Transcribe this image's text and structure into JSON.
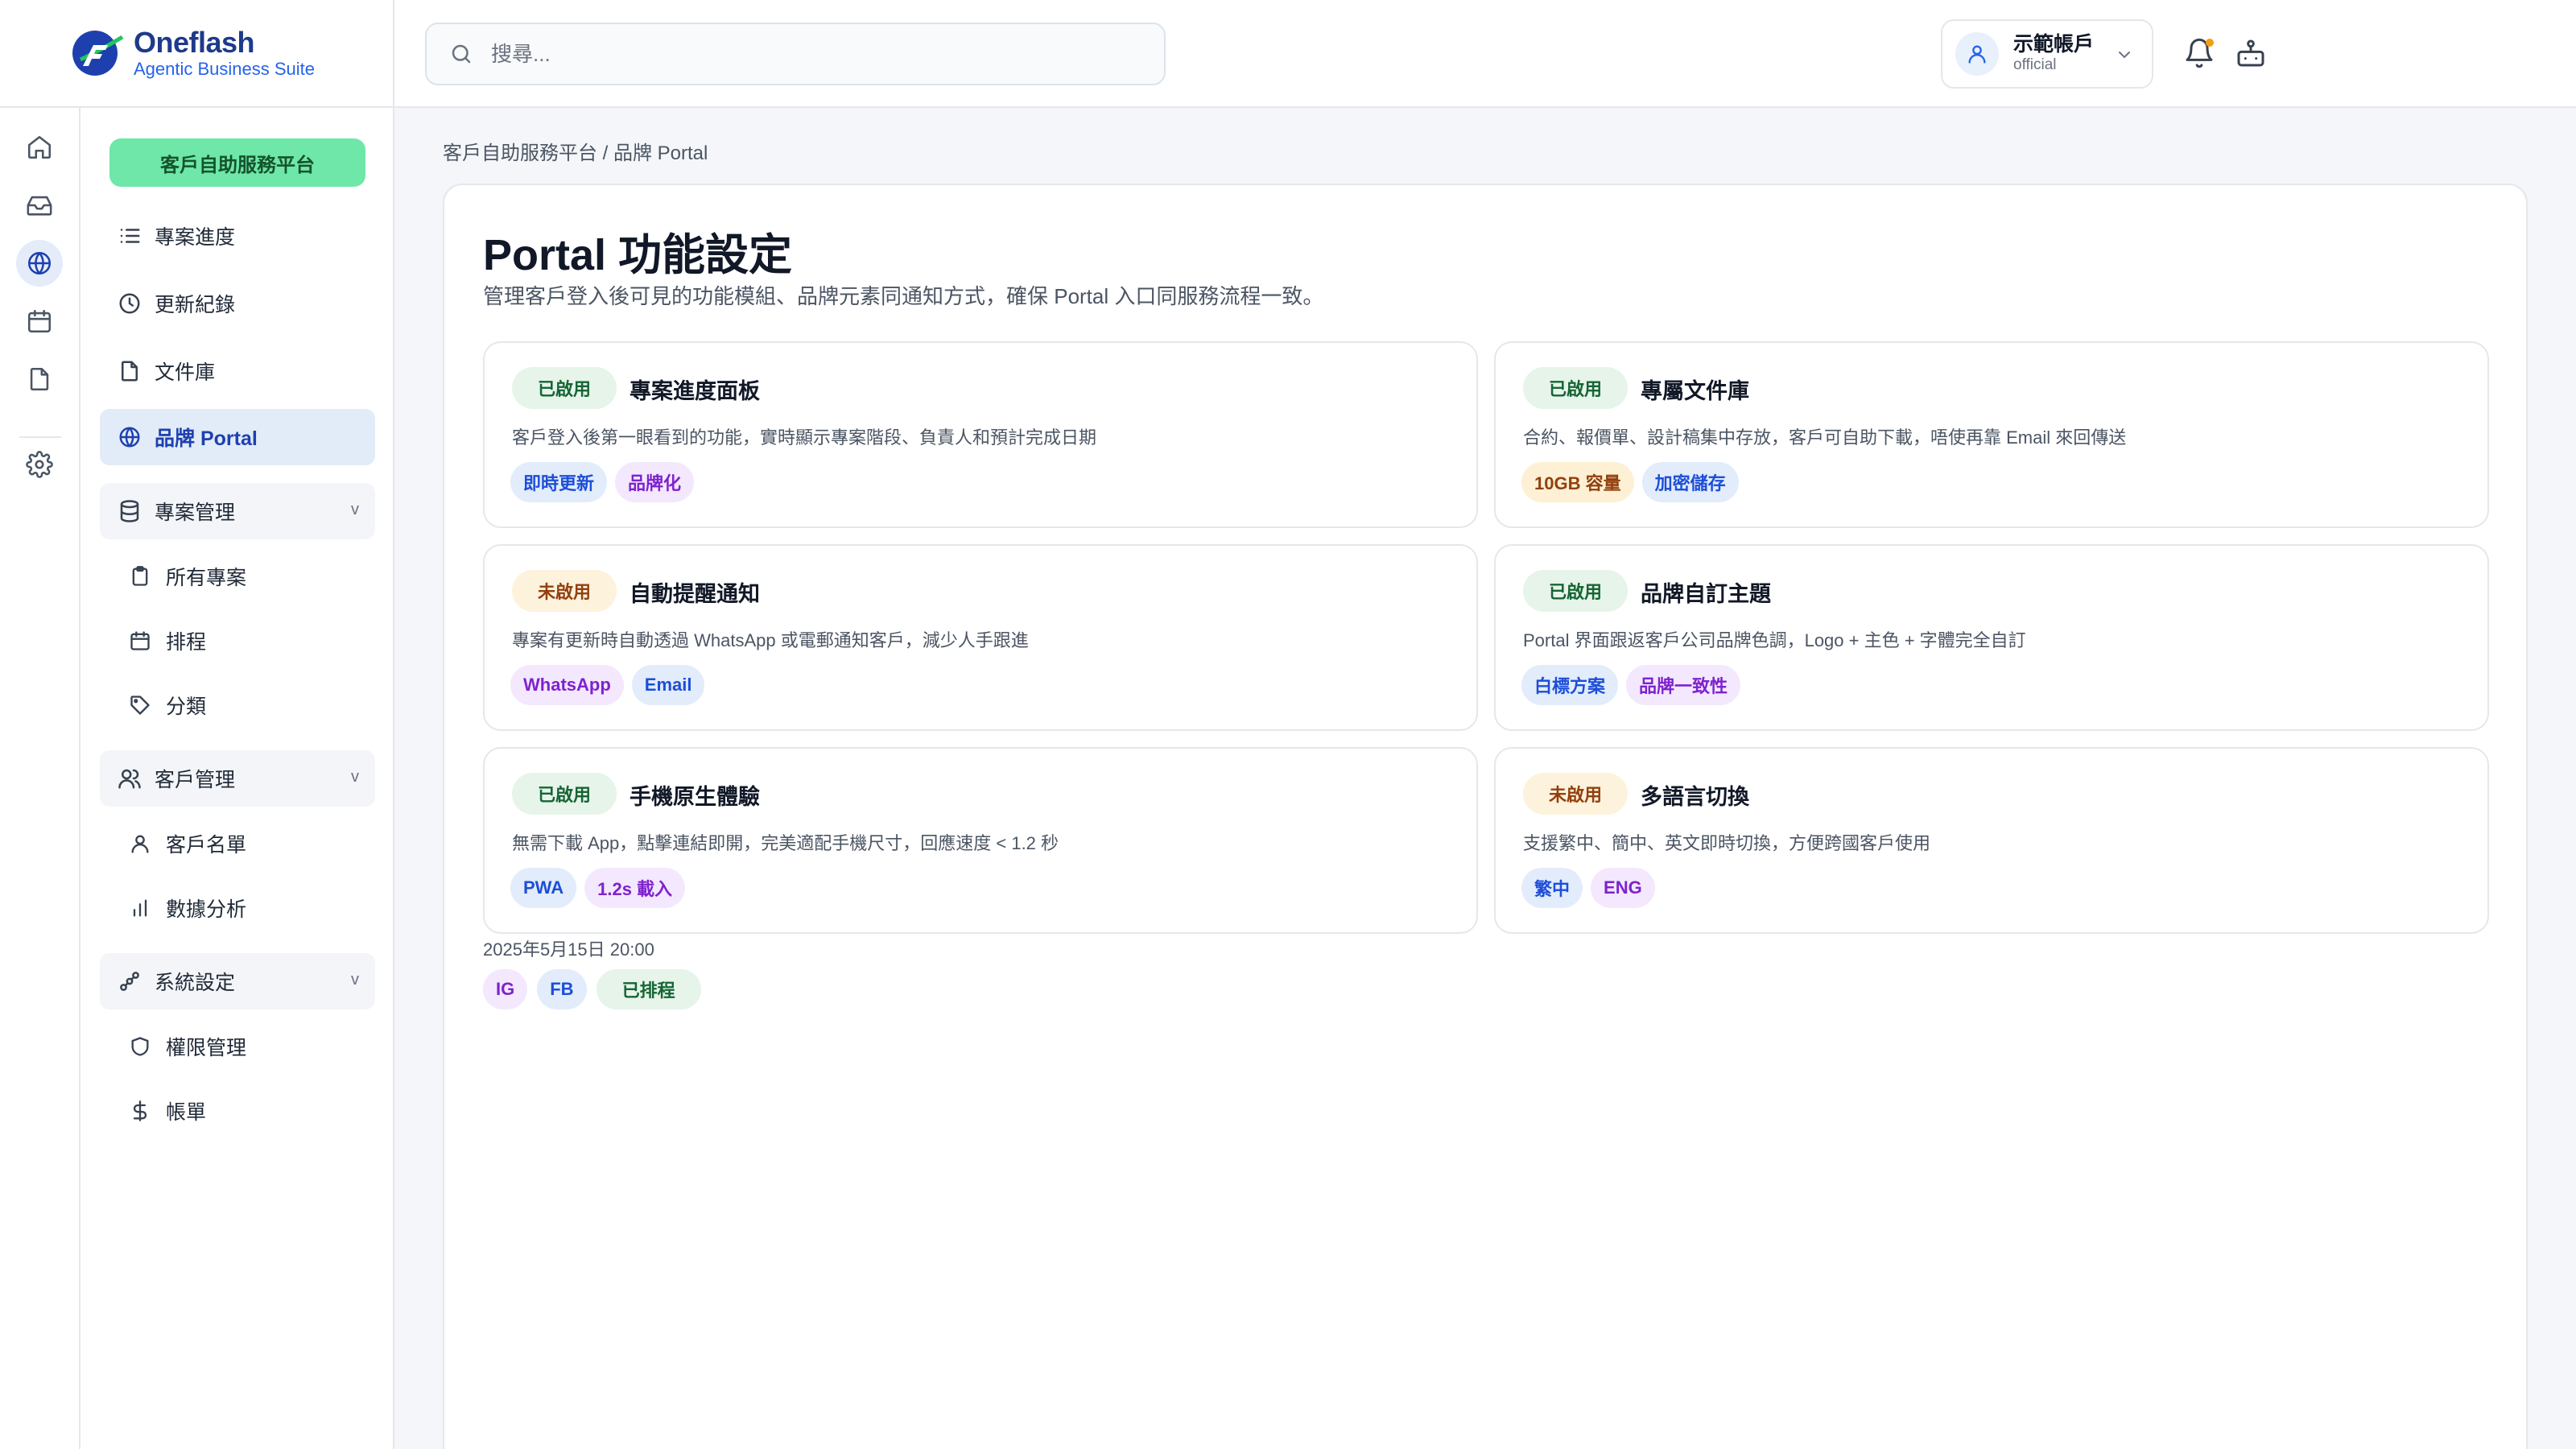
{
  "brand": {
    "name": "Oneflash",
    "tagline": "Agentic Business Suite"
  },
  "search": {
    "placeholder": "搜尋..."
  },
  "account": {
    "name": "示範帳戶",
    "role": "official"
  },
  "rail": {
    "icons": [
      "home-icon",
      "inbox-icon",
      "globe-icon",
      "calendar-icon",
      "file-icon",
      "gear-icon"
    ],
    "active": "globe-icon"
  },
  "sidebar": {
    "platform_button": "客戶自助服務平台",
    "items": [
      {
        "label": "專案進度",
        "icon": "list-icon"
      },
      {
        "label": "更新紀錄",
        "icon": "clock-icon"
      },
      {
        "label": "文件庫",
        "icon": "file-icon"
      },
      {
        "label": "品牌 Portal",
        "icon": "globe-icon",
        "active": true
      }
    ],
    "groups": [
      {
        "label": "專案管理",
        "icon": "database-icon",
        "chevron": "v",
        "children": [
          {
            "label": "所有專案",
            "icon": "clipboard-icon"
          },
          {
            "label": "排程",
            "icon": "calendar-icon"
          },
          {
            "label": "分類",
            "icon": "tag-icon"
          }
        ]
      },
      {
        "label": "客戶管理",
        "icon": "users-icon",
        "chevron": "v",
        "children": [
          {
            "label": "客戶名單",
            "icon": "user-icon"
          },
          {
            "label": "數據分析",
            "icon": "bar-chart-icon"
          }
        ]
      },
      {
        "label": "系統設定",
        "icon": "workflow-icon",
        "chevron": "v",
        "children": [
          {
            "label": "權限管理",
            "icon": "shield-icon"
          },
          {
            "label": "帳單",
            "icon": "dollar-icon"
          }
        ]
      }
    ]
  },
  "breadcrumb": "客戶自助服務平台 / 品牌 Portal",
  "page": {
    "title": "Portal 功能設定",
    "description": "管理客戶登入後可見的功能模組、品牌元素同通知方式，確保 Portal 入口同服務流程一致。"
  },
  "cards": [
    {
      "status": "已啟用",
      "enabled": true,
      "title": "專案進度面板",
      "desc": "客戶登入後第一眼看到的功能，實時顯示專案階段、負責人和預計完成日期",
      "tags": [
        {
          "label": "即時更新",
          "color": "blue"
        },
        {
          "label": "品牌化",
          "color": "purple"
        }
      ]
    },
    {
      "status": "已啟用",
      "enabled": true,
      "title": "專屬文件庫",
      "desc": "合約、報價單、設計稿集中存放，客戶可自助下載，唔使再靠 Email 來回傳送",
      "tags": [
        {
          "label": "10GB 容量",
          "color": "amber"
        },
        {
          "label": "加密儲存",
          "color": "blue"
        }
      ]
    },
    {
      "status": "未啟用",
      "enabled": false,
      "title": "自動提醒通知",
      "desc": "專案有更新時自動透過 WhatsApp 或電郵通知客戶，減少人手跟進",
      "tags": [
        {
          "label": "WhatsApp",
          "color": "purple"
        },
        {
          "label": "Email",
          "color": "blue"
        }
      ]
    },
    {
      "status": "已啟用",
      "enabled": true,
      "title": "品牌自訂主題",
      "desc": "Portal 界面跟返客戶公司品牌色調，Logo + 主色 + 字體完全自訂",
      "tags": [
        {
          "label": "白標方案",
          "color": "blue"
        },
        {
          "label": "品牌一致性",
          "color": "purple"
        }
      ]
    },
    {
      "status": "已啟用",
      "enabled": true,
      "title": "手機原生體驗",
      "desc": "無需下載 App，點擊連結即開，完美適配手機尺寸，回應速度 < 1.2 秒",
      "tags": [
        {
          "label": "PWA",
          "color": "blue"
        },
        {
          "label": "1.2s 載入",
          "color": "purple"
        }
      ]
    },
    {
      "status": "未啟用",
      "enabled": false,
      "title": "多語言切換",
      "desc": "支援繁中、簡中、英文即時切換，方便跨國客戶使用",
      "tags": [
        {
          "label": "繁中",
          "color": "blue"
        },
        {
          "label": "ENG",
          "color": "purple"
        }
      ]
    }
  ],
  "schedule": {
    "timestamp": "2025年5月15日 20:00",
    "tags": [
      {
        "label": "IG",
        "color": "purple"
      },
      {
        "label": "FB",
        "color": "blue"
      },
      {
        "label": "已排程",
        "color": "green"
      }
    ]
  },
  "colors": {
    "primary": "#1e40af",
    "accent_green": "#6ee7a8",
    "active_bg": "#e2ecf8"
  }
}
